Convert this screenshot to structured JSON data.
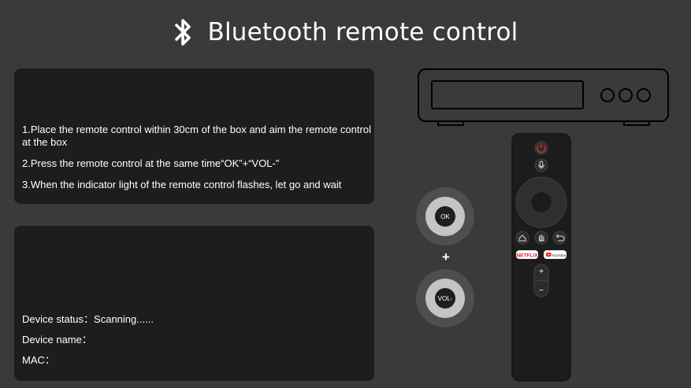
{
  "header": {
    "title": "Bluetooth remote control",
    "icon": "bluetooth-icon"
  },
  "instructions": {
    "steps": [
      "1.Place the remote control within 30cm of the box and aim the remote control at the box",
      "2.Press the remote control at the same time“OK”+“VOL-”",
      "3.When the indicator light of the remote control flashes, let go and wait"
    ]
  },
  "status": {
    "device_status_label": "Device status：",
    "device_status_value": "Scanning......",
    "device_name_label": "Device name：",
    "device_name_value": "",
    "mac_label": "MAC：",
    "mac_value": ""
  },
  "illustration": {
    "ok_button_label": "OK",
    "vol_button_label": "VOL-",
    "plus_label": "+",
    "remote": {
      "netflix_label": "NETFLIX",
      "youtube_label": "YouTube",
      "vol_plus": "+",
      "vol_minus": "−",
      "icons": [
        "power-icon",
        "mic-icon",
        "home-icon",
        "hand-icon",
        "back-icon"
      ]
    }
  },
  "colors": {
    "background": "#3a3a3a",
    "panel": "#1d1d1d",
    "power_red": "#e03030",
    "netflix_red": "#d81f26",
    "youtube_red": "#e62117"
  }
}
